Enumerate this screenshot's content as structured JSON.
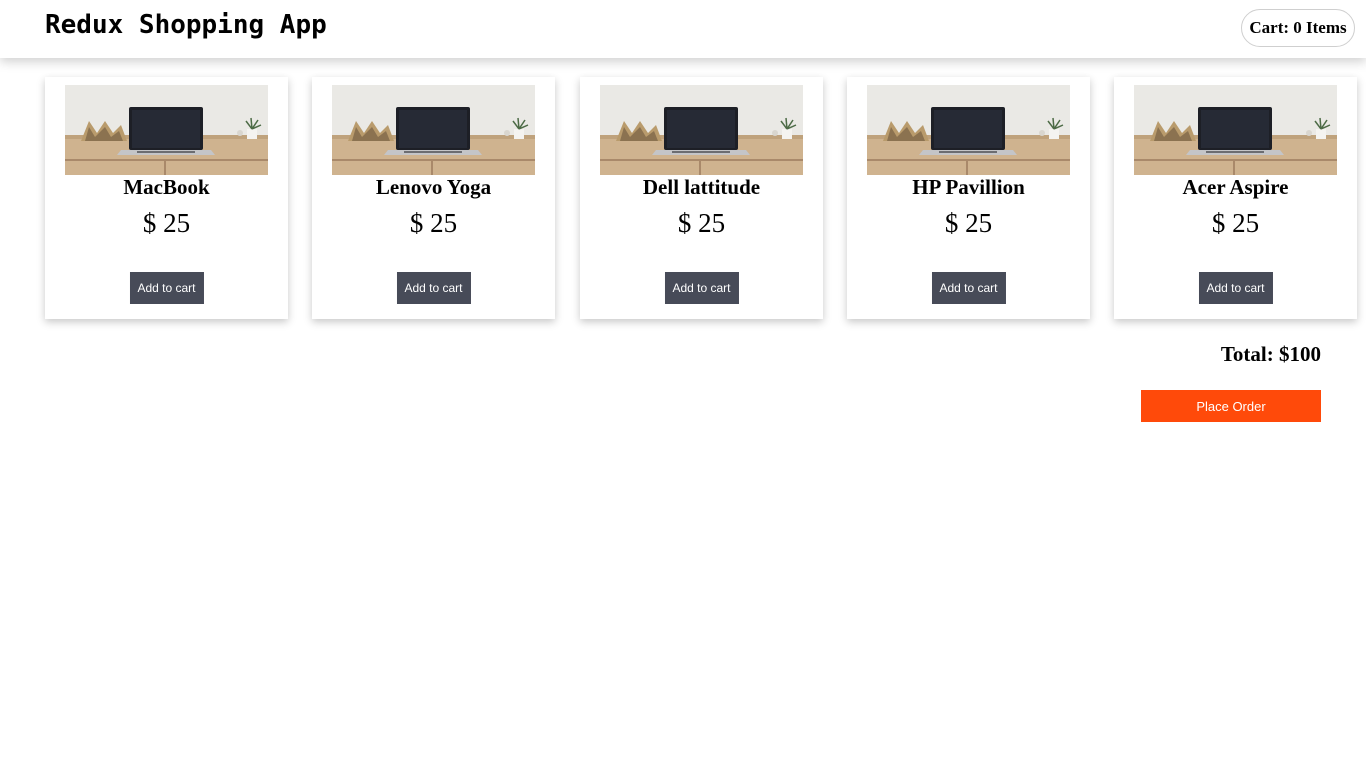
{
  "header": {
    "title": "Redux Shopping App",
    "cart_label": "Cart: 0 Items"
  },
  "products": [
    {
      "name": "MacBook",
      "price": "$ 25",
      "button": "Add to cart"
    },
    {
      "name": "Lenovo Yoga",
      "price": "$ 25",
      "button": "Add to cart"
    },
    {
      "name": "Dell lattitude",
      "price": "$ 25",
      "button": "Add to cart"
    },
    {
      "name": "HP Pavillion",
      "price": "$ 25",
      "button": "Add to cart"
    },
    {
      "name": "Acer Aspire",
      "price": "$ 25",
      "button": "Add to cart"
    }
  ],
  "summary": {
    "total": "Total: $100",
    "place_order": "Place Order"
  },
  "colors": {
    "add_button": "#474b58",
    "place_order": "#ff4a0a"
  }
}
